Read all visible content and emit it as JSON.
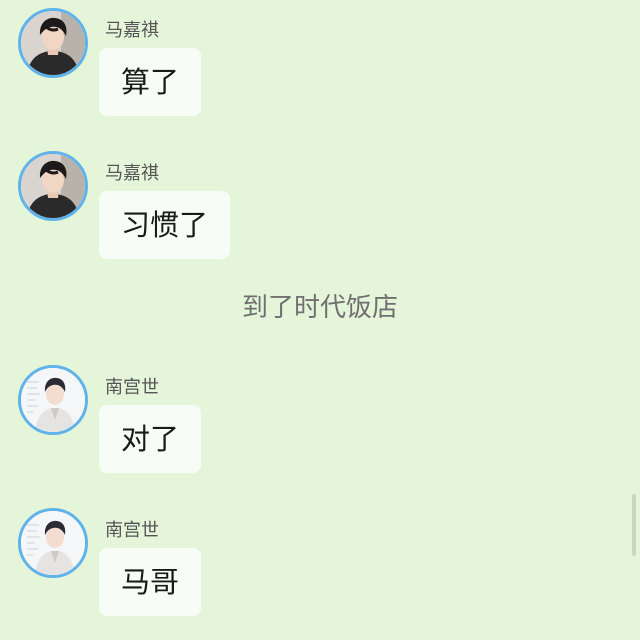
{
  "messages": [
    {
      "sender": "马嘉祺",
      "text": "算了",
      "avatar": "avatar-dark-photo"
    },
    {
      "sender": "马嘉祺",
      "text": "习惯了",
      "avatar": "avatar-dark-photo"
    },
    {
      "sender": "南宫世",
      "text": "对了",
      "avatar": "avatar-light-photo"
    },
    {
      "sender": "南宫世",
      "text": "马哥",
      "avatar": "avatar-light-photo"
    }
  ],
  "system_message": "到了时代饭店",
  "colors": {
    "background": "#e4f5da",
    "bubble": "#f8fcf6",
    "avatar_border": "#5fb3ea"
  }
}
